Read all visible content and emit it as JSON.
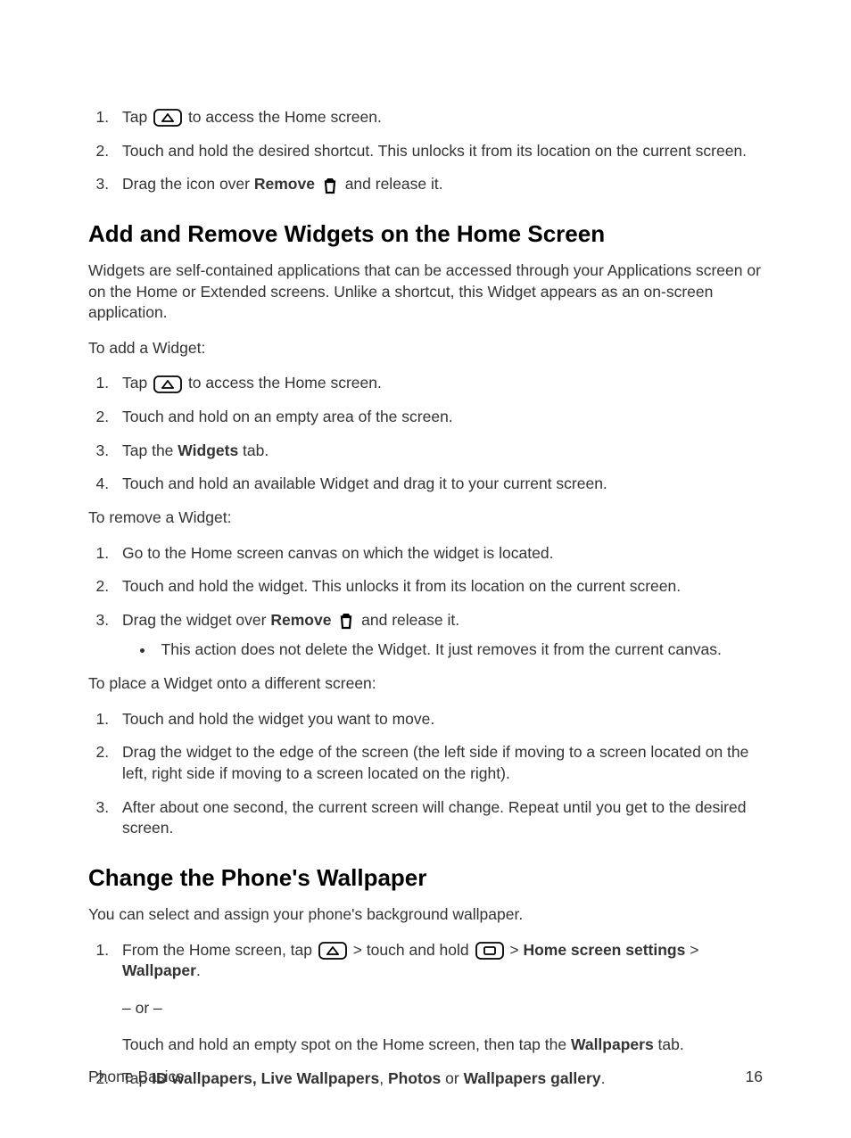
{
  "remove_shortcut": {
    "step1_a": "Tap ",
    "step1_b": " to access the Home screen.",
    "step2": "Touch and hold the desired shortcut. This unlocks it from its location on the current screen.",
    "step3_a": "Drag the icon over ",
    "step3_remove": "Remove",
    "step3_b": " and release it."
  },
  "section1": {
    "title": "Add and Remove Widgets on the Home Screen",
    "intro": "Widgets are self-contained applications that can be accessed through your Applications screen or on the Home or Extended screens. Unlike a shortcut, this Widget appears as an on-screen application.",
    "add_heading": "To add a Widget:",
    "add_step1_a": "Tap ",
    "add_step1_b": " to access the Home screen.",
    "add_step2": "Touch and hold on an empty area of the screen.",
    "add_step3_a": "Tap the ",
    "add_step3_bold": "Widgets",
    "add_step3_b": " tab.",
    "add_step4": "Touch and hold an available Widget and drag it to your current screen.",
    "remove_heading": "To remove a Widget:",
    "rem_step1": "Go to the Home screen canvas on which the widget is located.",
    "rem_step2": "Touch and hold the widget. This unlocks it from its location on the current screen.",
    "rem_step3_a": "Drag the widget over ",
    "rem_step3_bold": "Remove",
    "rem_step3_b": " and release it.",
    "rem_bullet": "This action does not delete the Widget. It just removes it from the current canvas.",
    "move_heading": "To place a Widget onto a different screen:",
    "mv_step1": "Touch and hold the widget you want to move.",
    "mv_step2": "Drag the widget to the edge of the screen (the left side if moving to a screen located on the left, right side if moving to a screen located on the right).",
    "mv_step3": "After about one second, the current screen will change. Repeat until you get to the desired screen."
  },
  "section2": {
    "title": "Change the Phone's Wallpaper",
    "intro": "You can select and assign your phone's background wallpaper.",
    "s1_a": "From the Home screen, tap ",
    "s1_b": " > touch and hold ",
    "s1_c": " > ",
    "s1_hss": "Home screen settings",
    "s1_d": " > ",
    "s1_wall": "Wallpaper",
    "s1_e": ".",
    "or": "– or –",
    "alt_a": "Touch and hold an empty spot on the Home screen, then tap the ",
    "alt_bold": "Wallpapers",
    "alt_b": " tab.",
    "s2_a": "Tap ",
    "s2_b1": "ID wallpapers, Live Wallpapers",
    "s2_b": ", ",
    "s2_b2": "Photos",
    "s2_c": " or ",
    "s2_b3": "Wallpapers gallery",
    "s2_d": "."
  },
  "footer": {
    "left": "Phone Basics",
    "right": "16"
  }
}
